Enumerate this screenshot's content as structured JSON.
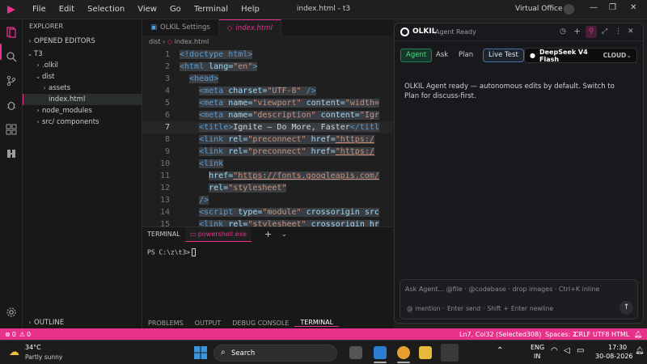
{
  "titlebar": {
    "menu": [
      "File",
      "Edit",
      "Selection",
      "View",
      "Go",
      "Terminal",
      "Help"
    ],
    "window_title": "index.html - t3",
    "account": "Virtual Office"
  },
  "sidebar": {
    "explorer_label": "EXPLORER",
    "open_editors_label": "OPENED EDITORS",
    "root_label": "T3",
    "tree": [
      ".olkil",
      "dist",
      "assets",
      "index.html",
      "node_modules",
      "src/ components"
    ],
    "outline_label": "OUTLINE"
  },
  "tabs": [
    "OLKIL Settings",
    "index.html"
  ],
  "breadcrumb": [
    "dist",
    "index.html"
  ],
  "code": {
    "line_numbers": [
      "1",
      "2",
      "3",
      "4",
      "5",
      "6",
      "7",
      "8",
      "9",
      "10",
      "11",
      "12",
      "13",
      "14",
      "15"
    ],
    "l1_tag": "<!doctype html>",
    "l2_tag": "<html",
    "l2_attr": "lang=",
    "l2_val": "\"en\"",
    "l2_end": ">",
    "l3_tag": "<head>",
    "l4_tag": "<meta",
    "l4_attr": "charset=",
    "l4_val": "\"UTF-8\"",
    "l4_end": "/>",
    "l5_tag": "<meta",
    "l5_attr1": "name=",
    "l5_val1": "\"viewport\"",
    "l5_attr2": "content=",
    "l5_rest": "\"width=",
    "l6_tag": "<meta",
    "l6_attr1": "name=",
    "l6_val1": "\"description\"",
    "l6_attr2": "content=",
    "l6_rest": "\"Igr",
    "l7_tag": "<title>",
    "l7_text": "Ignite — Do More, Faster",
    "l7_end": "</titl",
    "l8_tag": "<link",
    "l8_attr1": "rel=",
    "l8_val1": "\"preconnect\"",
    "l8_attr2": "href=",
    "l8_url": "\"https:/",
    "l9_tag": "<link",
    "l9_attr1": "rel=",
    "l9_val1": "\"preconnect\"",
    "l9_attr2": "href=",
    "l9_url": "\"https:/",
    "l10_tag": "<link",
    "l11_attr": "href=",
    "l11_url": "\"https://fonts.googleapis.com/",
    "l12_attr": "rel=",
    "l12_val": "\"stylesheet\"",
    "l13_tag": "/>",
    "l14_tag": "<script",
    "l14_attr1": "type=",
    "l14_val1": "\"module\"",
    "l14_attr2": "crossorigin",
    "l14_attr3": "src",
    "l15_tag": "<link",
    "l15_attr1": "rel=",
    "l15_val1": "\"stylesheet\"",
    "l15_attr2": "crossorigin",
    "l15_attr3": "hr"
  },
  "panel": {
    "tabs": [
      "TERMINAL",
      "powershell.exe"
    ],
    "prompt": "PS C:\\z\\t3>",
    "bottom_tabs": [
      "PROBLEMS",
      "OUTPUT",
      "DEBUG CONSOLE",
      "TERMINAL"
    ]
  },
  "agent": {
    "name": "OLKIL",
    "subtitle": "Agent",
    "status": "Ready",
    "modes": [
      "Agent",
      "Ask",
      "Plan"
    ],
    "live_test": "Live Test",
    "model": "DeepSeek V4 Flash",
    "model_tag": "CLOUD",
    "message": "OLKIL Agent ready — autonomous edits by default. Switch to Plan for discuss-first.",
    "input_placeholder": "Ask Agent... @file · @codebase · drop images · Ctrl+K inline",
    "hints": [
      "@",
      "mention",
      "·",
      "Enter",
      "send",
      "·",
      "Shift",
      "+",
      "Enter",
      "newline"
    ]
  },
  "statusbar": {
    "errors": "0",
    "warnings": "0",
    "position": "Ln7, Col32 (Selected308)",
    "spaces": "Spaces: 2",
    "eol": "CRLF",
    "encoding": "UTF8",
    "language": "HTML"
  },
  "taskbar": {
    "temp": "34°C",
    "weather": "Partly sunny",
    "search": "Search",
    "lang1": "ENG",
    "lang2": "IN",
    "time": "17:30",
    "date": "30-08-2026"
  }
}
